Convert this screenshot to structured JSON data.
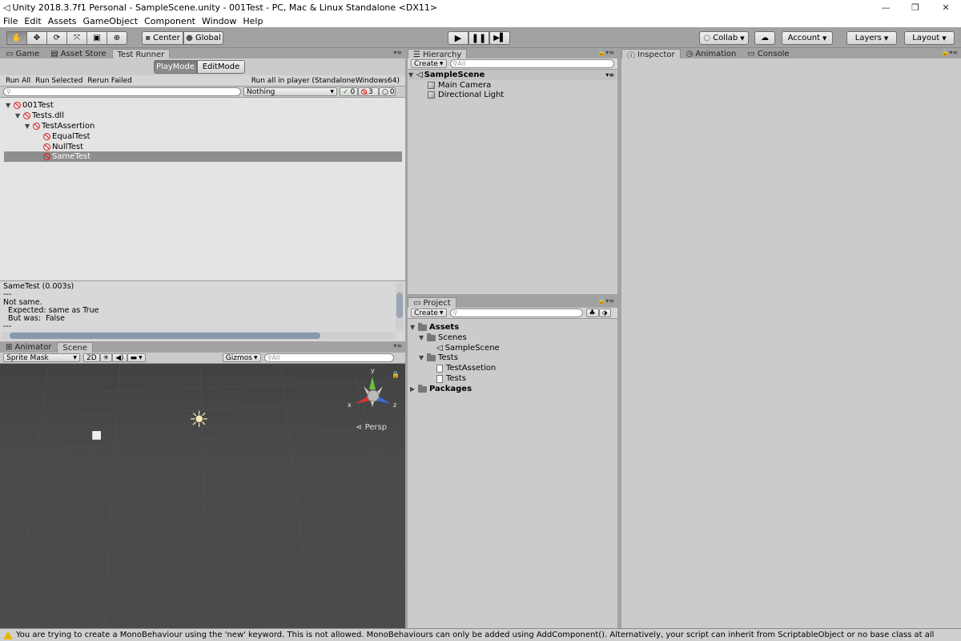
{
  "window": {
    "title": "Unity 2018.3.7f1 Personal - SampleScene.unity - 001Test - PC, Mac & Linux Standalone <DX11>"
  },
  "menu": [
    "File",
    "Edit",
    "Assets",
    "GameObject",
    "Component",
    "Window",
    "Help"
  ],
  "toolbar": {
    "center": "Center",
    "global": "Global",
    "collab": "Collab",
    "account": "Account",
    "layers": "Layers",
    "layout": "Layout"
  },
  "left_tabs": [
    "Game",
    "Asset Store",
    "Test Runner"
  ],
  "test_runner": {
    "playmode": "PlayMode",
    "editmode": "EditMode",
    "run_all": "Run All",
    "run_selected": "Run Selected",
    "rerun_failed": "Rerun Failed",
    "run_player": "Run all in player (StandaloneWindows64)",
    "filter": "Nothing",
    "pass_count": "0",
    "fail_count": "3",
    "skip_count": "0",
    "tree": [
      "001Test",
      "Tests.dll",
      "TestAssertion",
      "EqualTest",
      "NullTest",
      "SameTest"
    ],
    "details": [
      "SameTest (0.003s)",
      "---",
      "Not same.",
      "  Expected: same as True",
      "  But was:  False",
      "---"
    ]
  },
  "hierarchy": {
    "tab": "Hierarchy",
    "create": "Create",
    "search_placeholder": "All",
    "scene": "SampleScene",
    "items": [
      "Main Camera",
      "Directional Light"
    ]
  },
  "project": {
    "tab": "Project",
    "create": "Create",
    "tree": [
      "Assets",
      "Scenes",
      "SampleScene",
      "Tests",
      "TestAssetion",
      "Tests",
      "Packages"
    ]
  },
  "scene_tabs": [
    "Animator",
    "Scene"
  ],
  "scene": {
    "mode": "Sprite Mask",
    "btn_2d": "2D",
    "gizmos": "Gizmos",
    "search_placeholder": "All",
    "persp": "Persp",
    "axis_x": "x",
    "axis_y": "y",
    "axis_z": "z"
  },
  "right_tabs": [
    "Inspector",
    "Animation",
    "Console"
  ],
  "status": "You are trying to create a MonoBehaviour using the 'new' keyword.  This is not allowed.  MonoBehaviours can only be added using AddComponent(). Alternatively, your script can inherit from ScriptableObject or no base class at all"
}
